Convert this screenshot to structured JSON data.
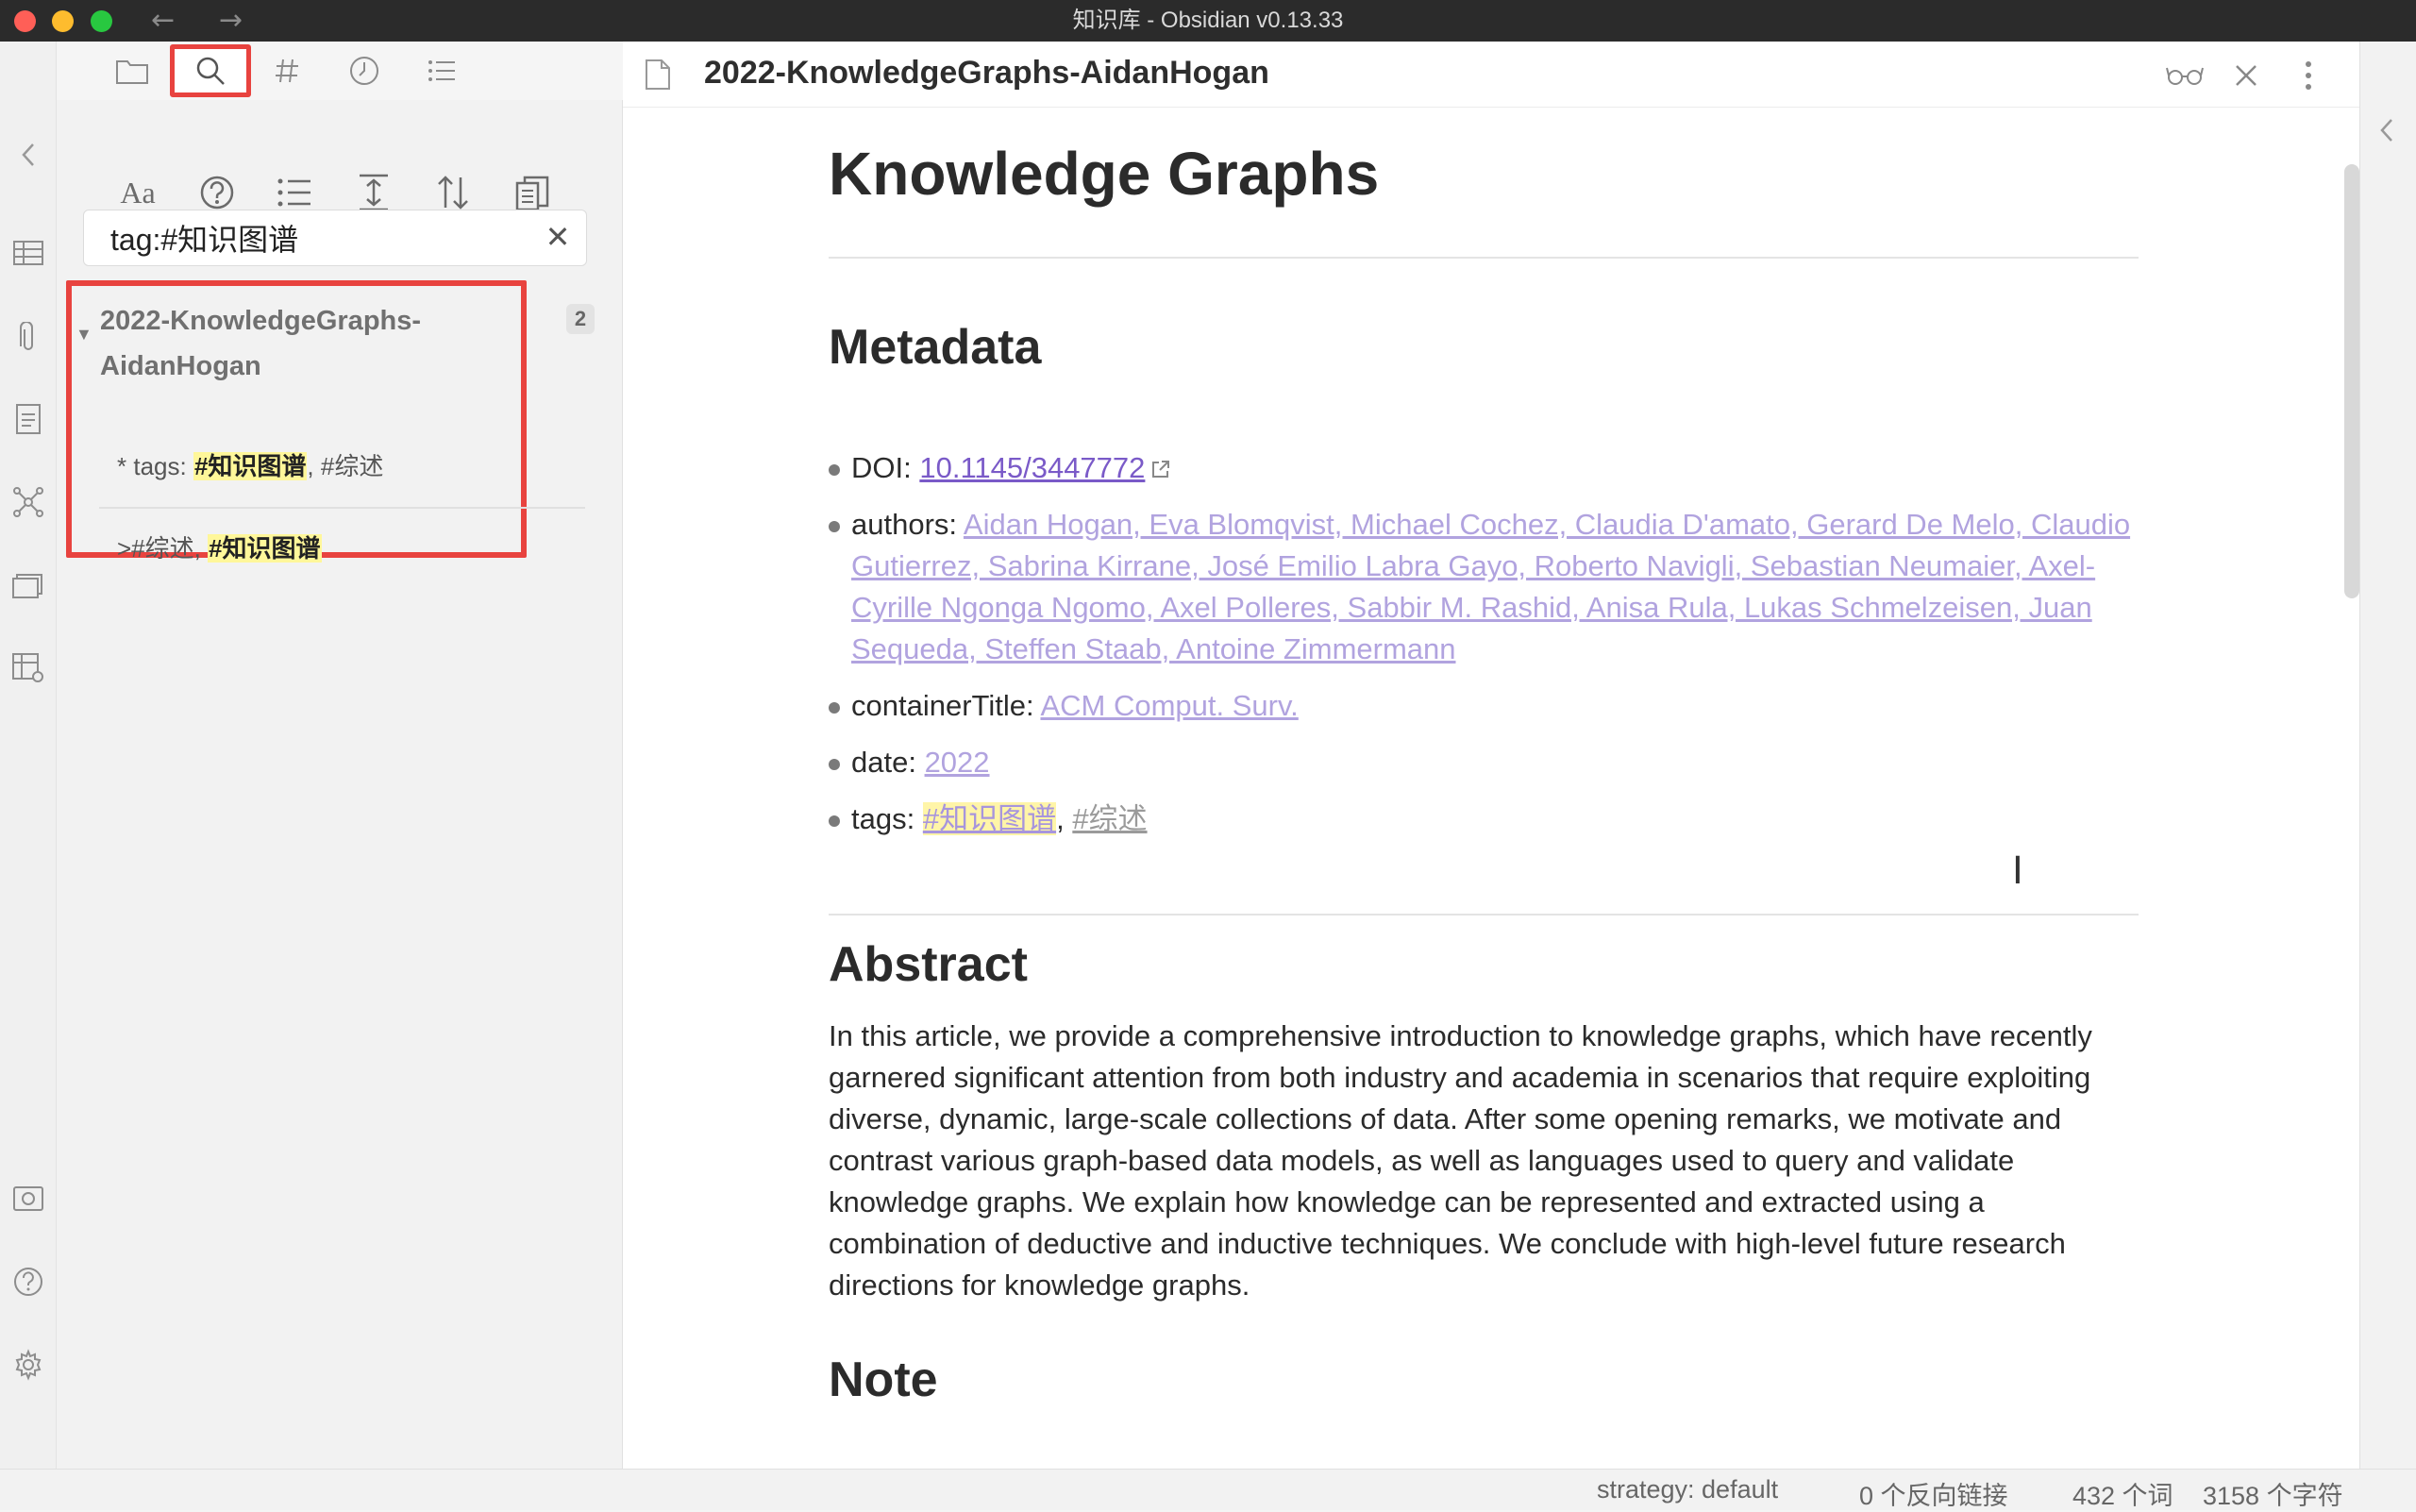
{
  "window": {
    "title": "知识库 - Obsidian v0.13.33",
    "nav_back": "←",
    "nav_forward": "→"
  },
  "sidebar": {
    "tabs": [
      "file-explorer",
      "search",
      "tags",
      "recent",
      "outline"
    ],
    "active_tab": "search",
    "tools": [
      "match-case",
      "help",
      "collapse-results",
      "expand-context",
      "sort",
      "copy-results"
    ],
    "search": {
      "value": "tag:#知识图谱",
      "clear": "✕"
    },
    "results": [
      {
        "title": "2022-KnowledgeGraphs-AidanHogan",
        "count": "2",
        "matches": [
          {
            "prefix": "* tags: ",
            "highlight": "#知识图谱",
            "suffix": ", #综述"
          },
          {
            "prefix": ">#综述, ",
            "highlight": "#知识图谱",
            "suffix": ""
          }
        ]
      }
    ]
  },
  "editor": {
    "tab_title": "2022-KnowledgeGraphs-AidanHogan",
    "heading": "Knowledge Graphs",
    "sections": {
      "metadata": "Metadata",
      "abstract": "Abstract",
      "note": "Note"
    },
    "metadata": {
      "doi_label": "DOI: ",
      "doi_value": "10.1145/3447772",
      "authors_label": "authors: ",
      "authors_value": "Aidan Hogan, Eva Blomqvist, Michael Cochez, Claudia D'amato, Gerard De Melo, Claudio Gutierrez, Sabrina Kirrane, José Emilio Labra Gayo, Roberto Navigli, Sebastian Neumaier, Axel-Cyrille Ngonga Ngomo, Axel Polleres, Sabbir M. Rashid, Anisa Rula, Lukas Schmelzeisen, Juan Sequeda, Steffen Staab, Antoine Zimmermann",
      "container_label": "containerTitle: ",
      "container_value": "ACM Comput. Surv.",
      "date_label": "date: ",
      "date_value": "2022",
      "tags_label": "tags: ",
      "tag1": "#知识图谱",
      "tag_sep": ", ",
      "tag2": "#综述"
    },
    "abstract_text": "In this article, we provide a comprehensive introduction to knowledge graphs, which have recently garnered significant attention from both industry and academia in scenarios that require exploiting diverse, dynamic, large-scale collections of data. After some opening remarks, we motivate and contrast various graph-based data models, as well as languages used to query and validate knowledge graphs. We explain how knowledge can be represented and extracted using a combination of deductive and inductive techniques. We conclude with high-level future research directions for knowledge graphs."
  },
  "statusbar": {
    "strategy": "strategy: default",
    "backlinks": "0 个反向链接",
    "words": "432 个词",
    "chars": "3158 个字符"
  },
  "colors": {
    "accent": "#7a5ac8",
    "highlight": "#fff79a",
    "annotation_red": "#e8433f"
  }
}
